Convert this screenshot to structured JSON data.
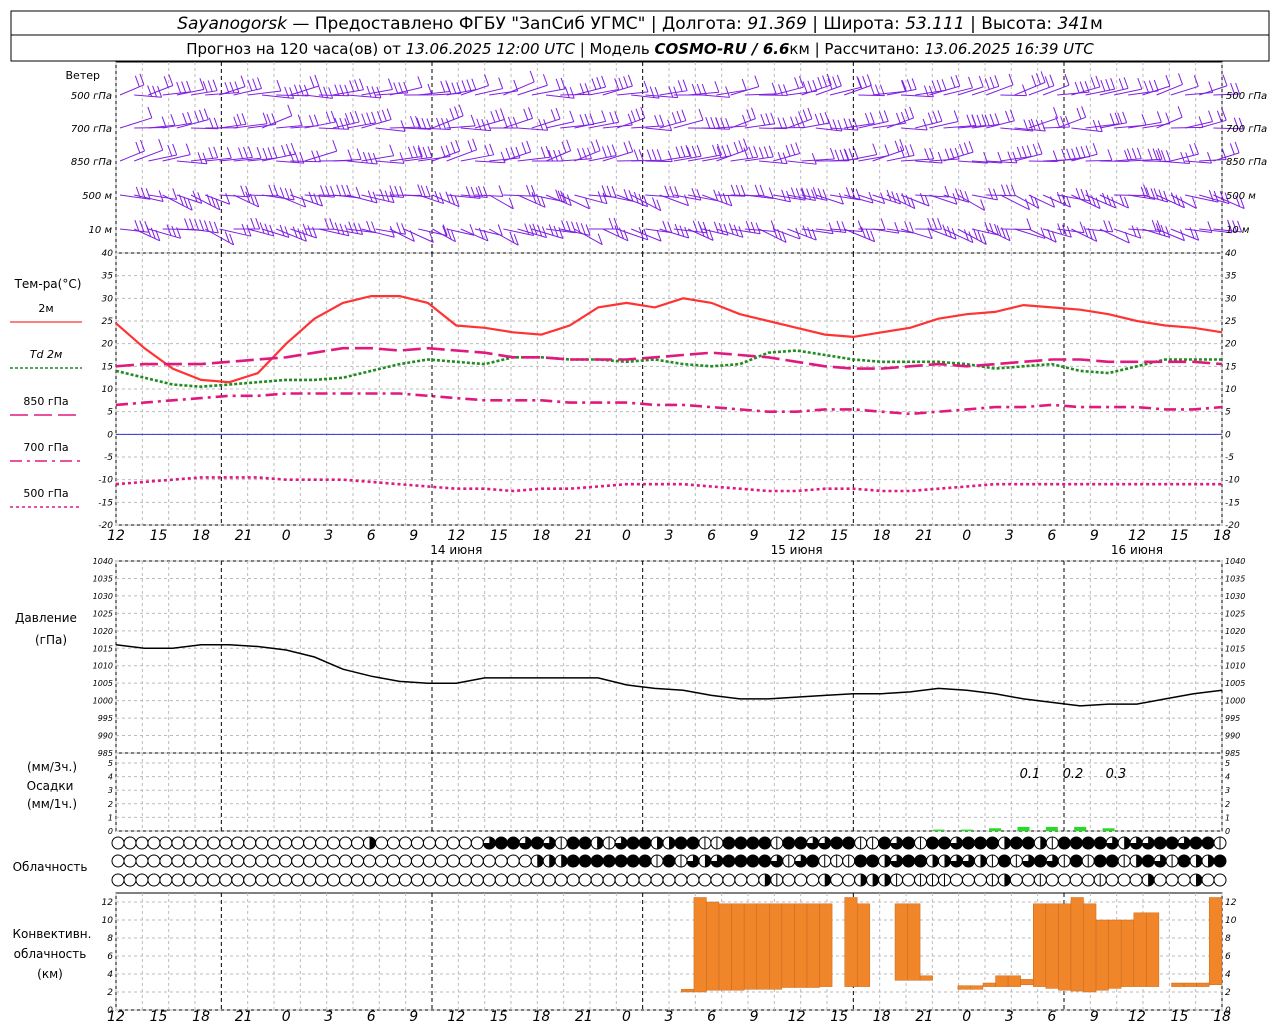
{
  "header": {
    "line1": {
      "station": "Sayanogorsk",
      "provider": " — Предоставлено ФГБУ \"ЗапСиб УГМС\" | Долгота: ",
      "lon": "91.369",
      "lat_label": " | Широта: ",
      "lat": "53.111",
      "alt_label": " | Высота: ",
      "alt": "341",
      "alt_unit": "м"
    },
    "line2": {
      "forecast_label": "Прогноз на 120 часа(ов) от ",
      "forecast_time": "13.06.2025 12:00 UTC",
      "model_label": "  | Модель ",
      "model": "COSMO-RU / 6.6",
      "model_unit": "км",
      "calc_label": " | Рассчитано: ",
      "calc_time": "13.06.2025 16:39 UTC"
    }
  },
  "wind": {
    "title": "Ветер",
    "levels": [
      "500 гПа",
      "700 гПа",
      "850 гПа",
      "500 м",
      "10  м"
    ],
    "color": "#7f1ee0"
  },
  "temperature": {
    "title": "Тем-ра(°C)",
    "legend": [
      {
        "label": "2м",
        "color": "#ff3333",
        "dash": "solid"
      },
      {
        "label": "Td  2м",
        "color": "#228b22",
        "dash": "dotted"
      },
      {
        "label": "850 гПа",
        "color": "#e0197f",
        "dash": "long"
      },
      {
        "label": "700 гПа",
        "color": "#e0197f",
        "dash": "dashdot"
      },
      {
        "label": "500 гПа",
        "color": "#e0197f",
        "dash": "dots"
      }
    ],
    "yticks": [
      "40",
      "35",
      "30",
      "25",
      "20",
      "15",
      "10",
      "5",
      "0",
      "-5",
      "-10",
      "-15",
      "-20"
    ],
    "ylim": [
      -20,
      40
    ]
  },
  "time_axis": {
    "labels": [
      "12",
      "15",
      "18",
      "21",
      "0",
      "3",
      "6",
      "9",
      "12",
      "15",
      "18",
      "21",
      "0",
      "3",
      "6",
      "9",
      "12",
      "15",
      "18",
      "21",
      "0",
      "3",
      "6",
      "9",
      "12",
      "15",
      "18"
    ],
    "dates": [
      "14 июня",
      "15 июня",
      "16 июня"
    ]
  },
  "pressure": {
    "title1": "Давление",
    "title2": "(гПа)",
    "yticks": [
      "1040",
      "1035",
      "1030",
      "1025",
      "1020",
      "1015",
      "1010",
      "1005",
      "1000",
      "995",
      "990",
      "985"
    ],
    "ylim": [
      985,
      1040
    ]
  },
  "precip": {
    "title1": "(мм/3ч.)",
    "title2": "Осадки",
    "title3": "(мм/1ч.)",
    "yticks": [
      "5",
      "4",
      "3",
      "2",
      "1",
      "0"
    ],
    "labels": [
      "0.1",
      "0.2",
      "0.3"
    ],
    "color": "#22dd22"
  },
  "cloud": {
    "title": "Облачность"
  },
  "convective": {
    "title1": "Конвективн.",
    "title2": "облачность",
    "title3": "(км)",
    "yticks": [
      "12",
      "10",
      "8",
      "6",
      "4",
      "2",
      "0"
    ],
    "color": "#f0852a"
  },
  "chart_data": [
    {
      "type": "line",
      "name": "temperature",
      "x_hours": [
        0,
        3,
        6,
        9,
        12,
        15,
        18,
        21,
        24,
        27,
        30,
        33,
        36,
        39,
        42,
        45,
        48,
        51,
        54,
        57,
        60,
        63,
        66,
        69,
        72,
        75,
        78,
        81,
        84,
        87,
        90,
        93,
        96,
        99,
        102,
        105,
        108,
        111,
        114,
        117
      ],
      "series": [
        {
          "name": "2м",
          "values": [
            24.5,
            19,
            14.5,
            12,
            11.5,
            13.5,
            20,
            25.5,
            29,
            30.5,
            30.5,
            29,
            24,
            23.5,
            22.5,
            22,
            24,
            28,
            29,
            28,
            30,
            29,
            26.5,
            25,
            23.5,
            22,
            21.5,
            22.5,
            23.5,
            25.5,
            26.5,
            27,
            28.5,
            28,
            27.5,
            26.5,
            25,
            24,
            23.5,
            22.5
          ]
        },
        {
          "name": "Td  2м",
          "values": [
            14,
            12.5,
            11,
            10.5,
            11,
            11.5,
            12,
            12,
            12.5,
            14,
            15.5,
            16.5,
            16,
            15.5,
            17,
            17,
            16.5,
            16.5,
            16,
            16.5,
            15.5,
            15,
            15.5,
            18,
            18.5,
            17.5,
            16.5,
            16,
            16,
            16,
            15.5,
            14.5,
            15,
            15.5,
            14,
            13.5,
            15,
            16.5,
            16.5,
            16.5
          ]
        },
        {
          "name": "850 гПа",
          "values": [
            15,
            15.5,
            15.5,
            15.5,
            16,
            16.5,
            17,
            18,
            19,
            19,
            18.5,
            19,
            18.5,
            18,
            17,
            17,
            16.5,
            16.5,
            16.5,
            17,
            17.5,
            18,
            17.5,
            17,
            16,
            15,
            14.5,
            14.5,
            15,
            15.5,
            15,
            15.5,
            16,
            16.5,
            16.5,
            16,
            16,
            16,
            16,
            15.5
          ]
        },
        {
          "name": "700 гПа",
          "values": [
            6.5,
            7,
            7.5,
            8,
            8.5,
            8.5,
            9,
            9,
            9,
            9,
            9,
            8.5,
            8,
            7.5,
            7.5,
            7.5,
            7,
            7,
            7,
            6.5,
            6.5,
            6,
            5.5,
            5,
            5,
            5.5,
            5.5,
            5,
            4.5,
            5,
            5.5,
            6,
            6,
            6.5,
            6,
            6,
            6,
            5.5,
            5.5,
            6
          ]
        },
        {
          "name": "500 гПа",
          "values": [
            -11,
            -10.5,
            -10,
            -9.5,
            -9.5,
            -9.5,
            -10,
            -10,
            -10,
            -10.5,
            -11,
            -11.5,
            -12,
            -12,
            -12.5,
            -12,
            -12,
            -11.5,
            -11,
            -11,
            -11,
            -11.5,
            -12,
            -12.5,
            -12.5,
            -12,
            -12,
            -12.5,
            -12.5,
            -12,
            -11.5,
            -11,
            -11,
            -11,
            -11,
            -11,
            -11,
            -11,
            -11,
            -11
          ]
        }
      ],
      "ylim": [
        -20,
        40
      ]
    },
    {
      "type": "line",
      "name": "pressure",
      "x_hours": [
        0,
        3,
        6,
        9,
        12,
        15,
        18,
        21,
        24,
        27,
        30,
        33,
        36,
        39,
        42,
        45,
        48,
        51,
        54,
        57,
        60,
        63,
        66,
        69,
        72,
        75,
        78,
        81,
        84,
        87,
        90,
        93,
        96,
        99,
        102,
        105,
        108,
        111,
        114,
        117
      ],
      "series": [
        {
          "name": "Давление",
          "values": [
            1016,
            1015,
            1015,
            1016,
            1016,
            1015.5,
            1014.5,
            1012.5,
            1009,
            1007,
            1005.5,
            1005,
            1005,
            1006.5,
            1006.5,
            1006.5,
            1006.5,
            1006.5,
            1004.5,
            1003.5,
            1003,
            1001.5,
            1000.5,
            1000.5,
            1001,
            1001.5,
            1002,
            1002,
            1002.5,
            1003.5,
            1003,
            1002,
            1000.5,
            999.5,
            998.5,
            999,
            999,
            1000.5,
            1002,
            1003
          ]
        }
      ],
      "ylim": [
        985,
        1040
      ]
    },
    {
      "type": "bar",
      "name": "precipitation",
      "x_hours": [
        87,
        90,
        93,
        96,
        99,
        102,
        105
      ],
      "values": [
        0.1,
        0.1,
        0.2,
        0.3,
        0.3,
        0.3,
        0.2
      ],
      "ylim": [
        0,
        5
      ]
    },
    {
      "type": "bar",
      "name": "convective_clouds",
      "bars": [
        {
          "x": 45.5,
          "bottom": 2,
          "top": 2.3
        },
        {
          "x": 46.5,
          "bottom": 2,
          "top": 12.5
        },
        {
          "x": 47.5,
          "bottom": 2.2,
          "top": 12
        },
        {
          "x": 48.5,
          "bottom": 2.2,
          "top": 11.8
        },
        {
          "x": 49.5,
          "bottom": 2.2,
          "top": 11.8
        },
        {
          "x": 50.5,
          "bottom": 2.3,
          "top": 11.8
        },
        {
          "x": 51.5,
          "bottom": 2.3,
          "top": 11.8
        },
        {
          "x": 52.5,
          "bottom": 2.3,
          "top": 11.8
        },
        {
          "x": 53.5,
          "bottom": 2.5,
          "top": 11.8
        },
        {
          "x": 54.5,
          "bottom": 2.5,
          "top": 11.8
        },
        {
          "x": 55.5,
          "bottom": 2.5,
          "top": 11.8
        },
        {
          "x": 56.5,
          "bottom": 2.6,
          "top": 11.8
        },
        {
          "x": 58.5,
          "bottom": 2.6,
          "top": 12.5
        },
        {
          "x": 59.5,
          "bottom": 2.6,
          "top": 11.8
        },
        {
          "x": 62.5,
          "bottom": 3.3,
          "top": 11.8
        },
        {
          "x": 63.5,
          "bottom": 3.3,
          "top": 11.8
        },
        {
          "x": 64.5,
          "bottom": 3.3,
          "top": 3.8
        },
        {
          "x": 67.5,
          "bottom": 2.3,
          "top": 2.7
        },
        {
          "x": 68.5,
          "bottom": 2.3,
          "top": 2.7
        },
        {
          "x": 69.5,
          "bottom": 2.6,
          "top": 3.0
        },
        {
          "x": 70.5,
          "bottom": 2.6,
          "top": 3.8
        },
        {
          "x": 71.5,
          "bottom": 2.6,
          "top": 3.8
        },
        {
          "x": 72.5,
          "bottom": 2.8,
          "top": 3.4
        },
        {
          "x": 73.5,
          "bottom": 2.6,
          "top": 11.8
        },
        {
          "x": 74.5,
          "bottom": 2.4,
          "top": 11.8
        },
        {
          "x": 75.5,
          "bottom": 2.2,
          "top": 11.8
        },
        {
          "x": 76.5,
          "bottom": 2.1,
          "top": 12.5
        },
        {
          "x": 77.5,
          "bottom": 2.0,
          "top": 11.8
        },
        {
          "x": 78.5,
          "bottom": 2.2,
          "top": 10.0
        },
        {
          "x": 79.5,
          "bottom": 2.4,
          "top": 10.0
        },
        {
          "x": 80.5,
          "bottom": 2.6,
          "top": 10.0
        },
        {
          "x": 81.5,
          "bottom": 2.6,
          "top": 10.8
        },
        {
          "x": 82.5,
          "bottom": 2.6,
          "top": 10.8
        },
        {
          "x": 84.5,
          "bottom": 2.6,
          "top": 3.0
        },
        {
          "x": 85.5,
          "bottom": 2.6,
          "top": 3.0
        },
        {
          "x": 86.5,
          "bottom": 2.6,
          "top": 3.0
        },
        {
          "x": 87.5,
          "bottom": 2.8,
          "top": 12.5
        }
      ],
      "ylim": [
        0,
        13
      ]
    }
  ]
}
